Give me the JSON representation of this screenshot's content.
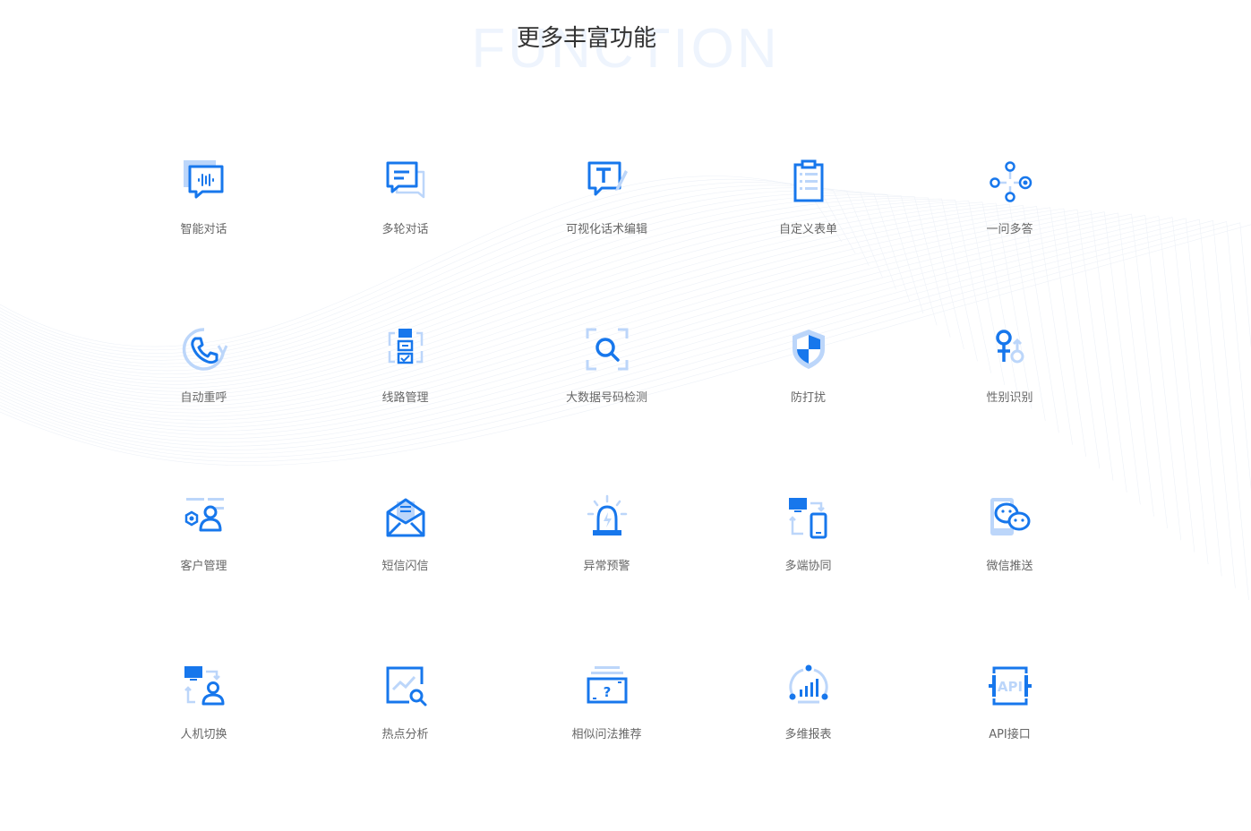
{
  "section": {
    "watermark": "FUNCTION",
    "title": "更多丰富功能"
  },
  "colors": {
    "primary": "#1777ec",
    "light": "#bcd6fa",
    "label": "#666666",
    "title": "#333333"
  },
  "features": [
    {
      "label": "智能对话",
      "icon": "chat-voice-icon"
    },
    {
      "label": "多轮对话",
      "icon": "chat-bubbles-icon"
    },
    {
      "label": "可视化话术编辑",
      "icon": "text-edit-icon"
    },
    {
      "label": "自定义表单",
      "icon": "clipboard-form-icon"
    },
    {
      "label": "一问多答",
      "icon": "nodes-icon"
    },
    {
      "label": "自动重呼",
      "icon": "phone-redial-icon"
    },
    {
      "label": "线路管理",
      "icon": "line-management-icon"
    },
    {
      "label": "大数据号码检测",
      "icon": "scan-search-icon"
    },
    {
      "label": "防打扰",
      "icon": "shield-icon"
    },
    {
      "label": "性别识别",
      "icon": "gender-icon"
    },
    {
      "label": "客户管理",
      "icon": "customer-icon"
    },
    {
      "label": "短信闪信",
      "icon": "envelope-icon"
    },
    {
      "label": "异常预警",
      "icon": "alarm-icon"
    },
    {
      "label": "多端协同",
      "icon": "multi-device-icon"
    },
    {
      "label": "微信推送",
      "icon": "wechat-icon"
    },
    {
      "label": "人机切换",
      "icon": "human-machine-switch-icon"
    },
    {
      "label": "热点分析",
      "icon": "trend-search-icon"
    },
    {
      "label": "相似问法推荐",
      "icon": "question-card-icon"
    },
    {
      "label": "多维报表",
      "icon": "bar-report-icon"
    },
    {
      "label": "API接口",
      "icon": "api-icon"
    }
  ]
}
